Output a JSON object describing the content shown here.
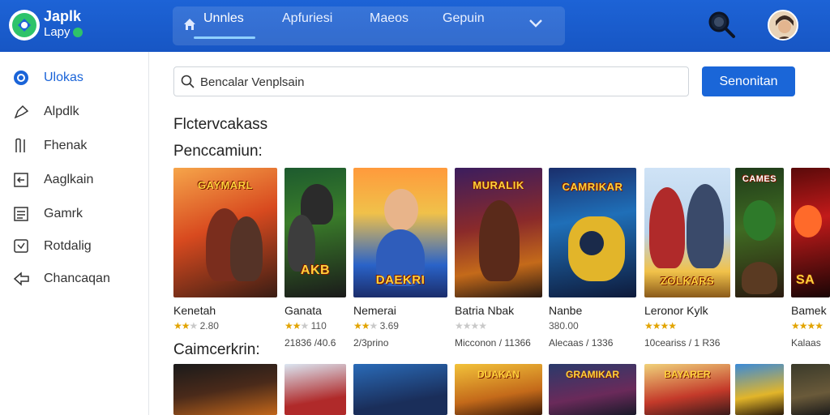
{
  "app": {
    "name_line1": "Japlk",
    "name_line2": "Lapy"
  },
  "nav": {
    "tabs": [
      "Unnles",
      "Apfuriesi",
      "Maeos",
      "Gepuin"
    ]
  },
  "sidebar": {
    "items": [
      {
        "label": "Ulokas",
        "icon": "home-circle-icon"
      },
      {
        "label": "Alpdlk",
        "icon": "arrow-icon"
      },
      {
        "label": "Fhenak",
        "icon": "book-icon"
      },
      {
        "label": "Aaglkain",
        "icon": "card-icon"
      },
      {
        "label": "Gamrk",
        "icon": "list-icon"
      },
      {
        "label": "Rotdalig",
        "icon": "message-icon"
      },
      {
        "label": "Chancaqan",
        "icon": "back-arrow-icon"
      }
    ]
  },
  "search": {
    "value": "Bencalar Venplsain",
    "button": "Senonitan"
  },
  "sections": {
    "heading1": "Flctervcakass",
    "heading2": "Penccamiun:",
    "heading3": "Caimcerkrin:"
  },
  "cards": [
    {
      "title": "GAYMARL",
      "name": "Kenetah",
      "rating": 2.5,
      "rating_text": "2.80",
      "meta": ""
    },
    {
      "title": "AKB",
      "name": "Ganata",
      "rating": 2.5,
      "rating_text": "110",
      "meta": "21836 /40.6"
    },
    {
      "title": "DAEKRI",
      "name": "Nemerai",
      "rating": 2.5,
      "rating_text": "3.69",
      "meta": "2/3prino"
    },
    {
      "title": "MURALIK",
      "name": "Batria Nbak",
      "rating": 0,
      "rating_text": "",
      "meta": "Micconon / 11366"
    },
    {
      "title": "CAMRIKAR",
      "name": "Nanbe",
      "rating": 0,
      "rating_text": "380.00",
      "meta": "Alecaas / 1336"
    },
    {
      "title": "ZOLKARS",
      "name": "Leronor Kylk",
      "rating": 4,
      "rating_text": "",
      "meta": "10ceariss / 1 R36"
    },
    {
      "title": "CAMES",
      "name": "",
      "rating": 0,
      "rating_text": "",
      "meta": ""
    },
    {
      "title": "SA",
      "name": "Bamek",
      "rating": 4,
      "rating_text": "",
      "meta": "Kalaas"
    }
  ],
  "cards_row2": [
    {
      "title": ""
    },
    {
      "title": ""
    },
    {
      "title": ""
    },
    {
      "title": "DUAKAN"
    },
    {
      "title": "GRAMIKAR"
    },
    {
      "title": "BAYARER"
    },
    {
      "title": ""
    },
    {
      "title": ""
    }
  ],
  "colors": {
    "brand": "#1a66d8",
    "topbar": "#1d63d6",
    "star": "#e2a400"
  }
}
